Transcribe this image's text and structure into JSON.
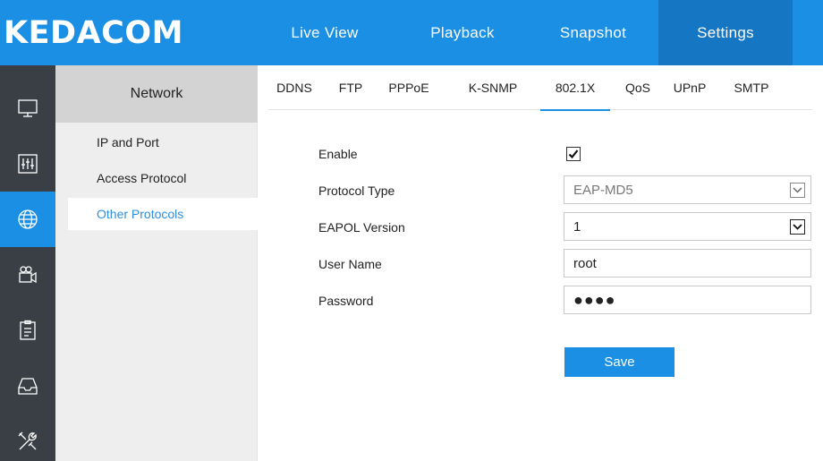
{
  "brand": {
    "logo_text": "KEDACOM"
  },
  "top_nav": [
    {
      "label": "Live View",
      "active": false
    },
    {
      "label": "Playback",
      "active": false
    },
    {
      "label": "Snapshot",
      "active": false
    },
    {
      "label": "Settings",
      "active": true
    }
  ],
  "sidebar_icons": [
    {
      "icon": "monitor-icon",
      "active": false
    },
    {
      "icon": "equalizer-icon",
      "active": false
    },
    {
      "icon": "globe-icon",
      "active": true
    },
    {
      "icon": "camera-icon",
      "active": false
    },
    {
      "icon": "clipboard-icon",
      "active": false
    },
    {
      "icon": "inbox-icon",
      "active": false
    },
    {
      "icon": "tools-icon",
      "active": false
    }
  ],
  "submenu": {
    "title": "Network",
    "items": [
      {
        "label": "IP and Port",
        "active": false
      },
      {
        "label": "Access Protocol",
        "active": false
      },
      {
        "label": "Other Protocols",
        "active": true
      }
    ]
  },
  "tabs": [
    {
      "label": "DDNS",
      "active": false
    },
    {
      "label": "FTP",
      "active": false
    },
    {
      "label": "PPPoE",
      "active": false
    },
    {
      "label": "K-SNMP",
      "active": false
    },
    {
      "label": "802.1X",
      "active": true
    },
    {
      "label": "QoS",
      "active": false
    },
    {
      "label": "UPnP",
      "active": false
    },
    {
      "label": "SMTP",
      "active": false
    }
  ],
  "form": {
    "enable": {
      "label": "Enable",
      "checked": true
    },
    "protocol_type": {
      "label": "Protocol Type",
      "value": "EAP-MD5",
      "disabled": true
    },
    "eapol_version": {
      "label": "EAPOL Version",
      "value": "1"
    },
    "user_name": {
      "label": "User Name",
      "value": "root"
    },
    "password": {
      "label": "Password",
      "masked_value": "●●●●"
    },
    "save_label": "Save"
  },
  "colors": {
    "accent": "#1a8fe3",
    "accent_dark": "#1577c4",
    "rail_bg": "#3a3f45",
    "link": "#2f8fdc"
  }
}
